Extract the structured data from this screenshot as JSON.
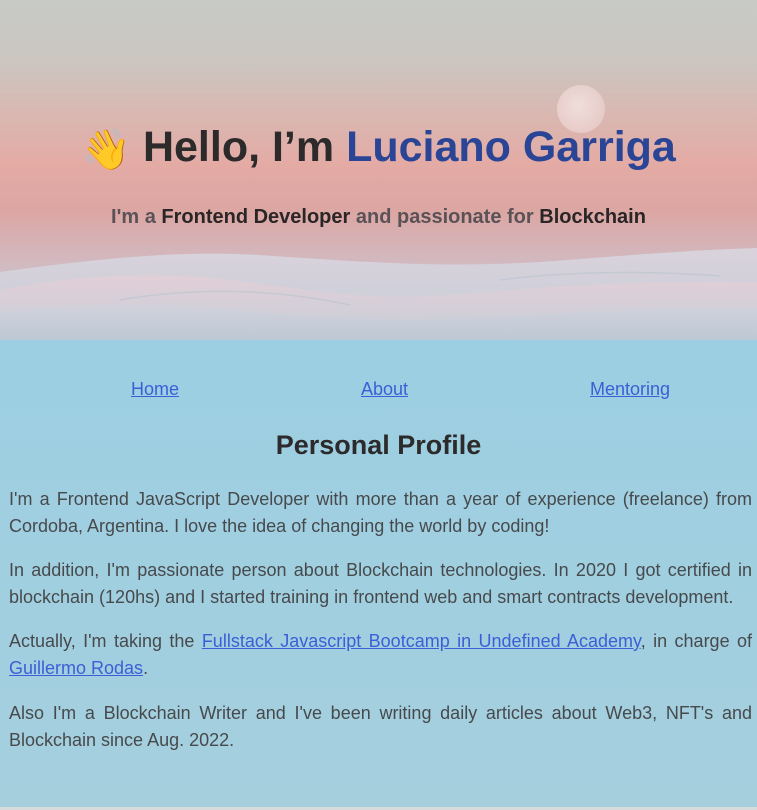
{
  "hero": {
    "wave_emoji": "👋",
    "greeting": "Hello, I’m ",
    "name": "Luciano Garriga",
    "sub_part1": "I'm a ",
    "sub_role": "Frontend Developer",
    "sub_part2": " and passionate for ",
    "sub_topic": "Blockchain"
  },
  "nav": {
    "items": [
      {
        "label": "Home"
      },
      {
        "label": "About"
      },
      {
        "label": "Mentoring"
      }
    ]
  },
  "profile": {
    "title": "Personal Profile",
    "p1": "I'm a Frontend JavaScript Developer with more than a year of experience (freelance) from Cordoba, Argentina. I love the idea of changing the world by coding!",
    "p2": "In addition, I'm passionate person about Blockchain technologies. In 2020 I got certified in blockchain (120hs) and I started training in frontend web and smart contracts development.",
    "p3_before": "Actually, I'm taking the ",
    "p3_link1": "Fullstack Javascript Bootcamp in Undefined Academy",
    "p3_middle": ", in charge of ",
    "p3_link2": "Guillermo Rodas",
    "p3_end": ".",
    "p4": "Also I'm a Blockchain Writer and I've been writing daily articles about Web3, NFT's and Blockchain since Aug. 2022."
  },
  "colors": {
    "accent_name": "#2a4595",
    "link": "#3b5fd6",
    "content_bg": "#9ccfe0"
  }
}
